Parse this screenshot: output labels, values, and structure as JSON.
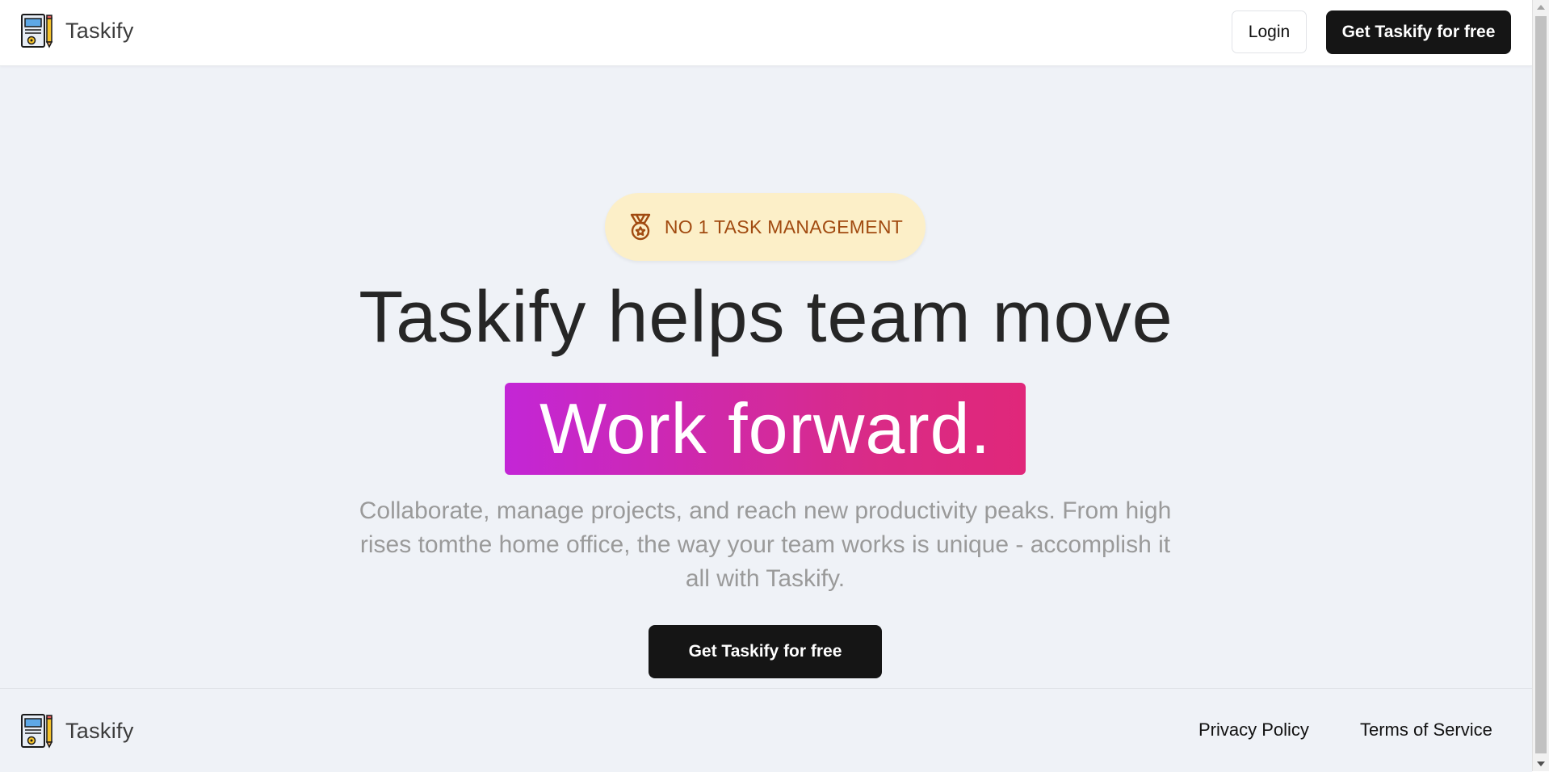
{
  "header": {
    "brand_name": "Taskify",
    "login_label": "Login",
    "cta_label": "Get Taskify for free"
  },
  "hero": {
    "badge_icon": "medal-icon",
    "badge_text": "NO 1 TASK MANAGEMENT",
    "headline": "Taskify helps team move",
    "highlight": "Work forward.",
    "subtext": "Collaborate, manage projects, and reach new productivity peaks. From high rises tomthe home office, the way your team works is unique - accomplish it all with Taskify.",
    "cta_label": "Get Taskify for free"
  },
  "footer": {
    "brand_name": "Taskify",
    "privacy_label": "Privacy Policy",
    "terms_label": "Terms of Service"
  },
  "colors": {
    "page_bg": "#eff2f7",
    "cta_bg": "#151515",
    "badge_bg": "#fcefc8",
    "badge_text": "#a14a10",
    "gradient_start": "#c326d6",
    "gradient_end": "#e0277a"
  }
}
